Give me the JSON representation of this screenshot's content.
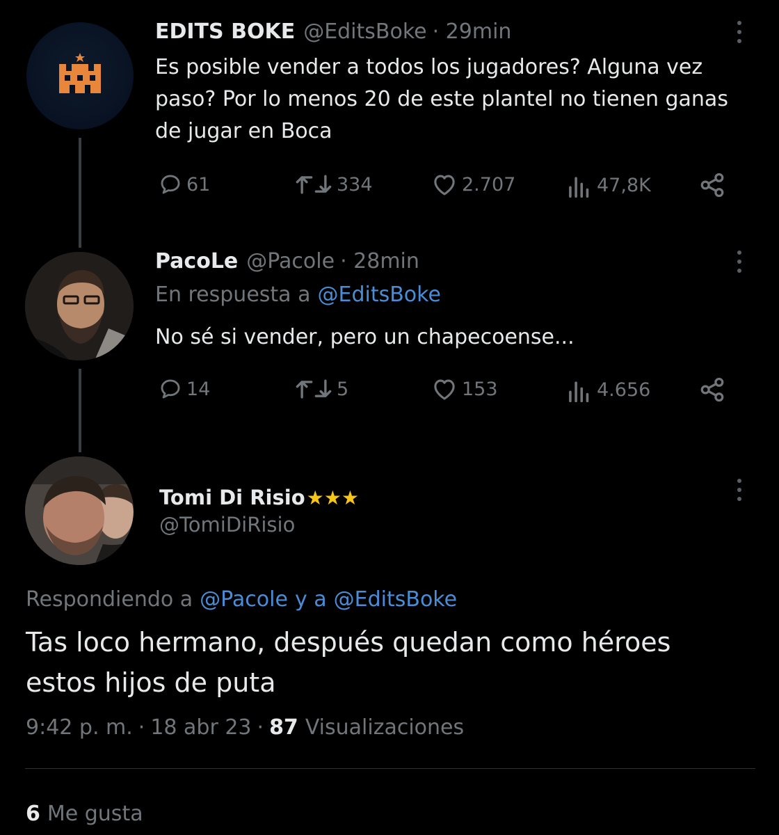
{
  "tweets": [
    {
      "name": "EDITS BOKE",
      "handle": "@EditsBoke",
      "time": "· 29min",
      "text": "Es posible vender a todos los jugadores? Alguna vez paso? Por lo menos 20 de este plantel no tienen ganas de jugar en Boca",
      "stats": {
        "replies": "61",
        "retweets": "334",
        "likes": "2.707",
        "views": "47,8K"
      }
    },
    {
      "name": "PacoLe",
      "handle": "@Pacole",
      "time": "· 28min",
      "reply_prefix": "En respuesta a",
      "reply_to": "@EditsBoke",
      "text": "No sé si vender, pero un chapecoense...",
      "stats": {
        "replies": "14",
        "retweets": "5",
        "likes": "153",
        "views": "4.656"
      }
    }
  ],
  "main": {
    "name": "Tomi Di Risio",
    "badge": "★★★",
    "handle": "@TomiDiRisio",
    "reply_prefix": "Respondiendo a",
    "reply_to_1": "@Pacole",
    "reply_joiner": "y a",
    "reply_to_2": "@EditsBoke",
    "text": "Tas loco hermano, después quedan como héroes estos hijos de puta",
    "time": "9:42 p. m.",
    "date": "18 abr 23",
    "views_count": "87",
    "views_label": "Visualizaciones",
    "likes_count": "6",
    "likes_label": "Me gusta"
  },
  "colors": {
    "background": "#000000",
    "text": "#e7e9ea",
    "muted": "#71767b",
    "link": "#4a8cd6",
    "castle": "#e8873b"
  },
  "icons": [
    "castle-logo-icon",
    "reply-icon",
    "retweet-icon",
    "like-icon",
    "views-icon",
    "share-icon",
    "more-icon"
  ]
}
